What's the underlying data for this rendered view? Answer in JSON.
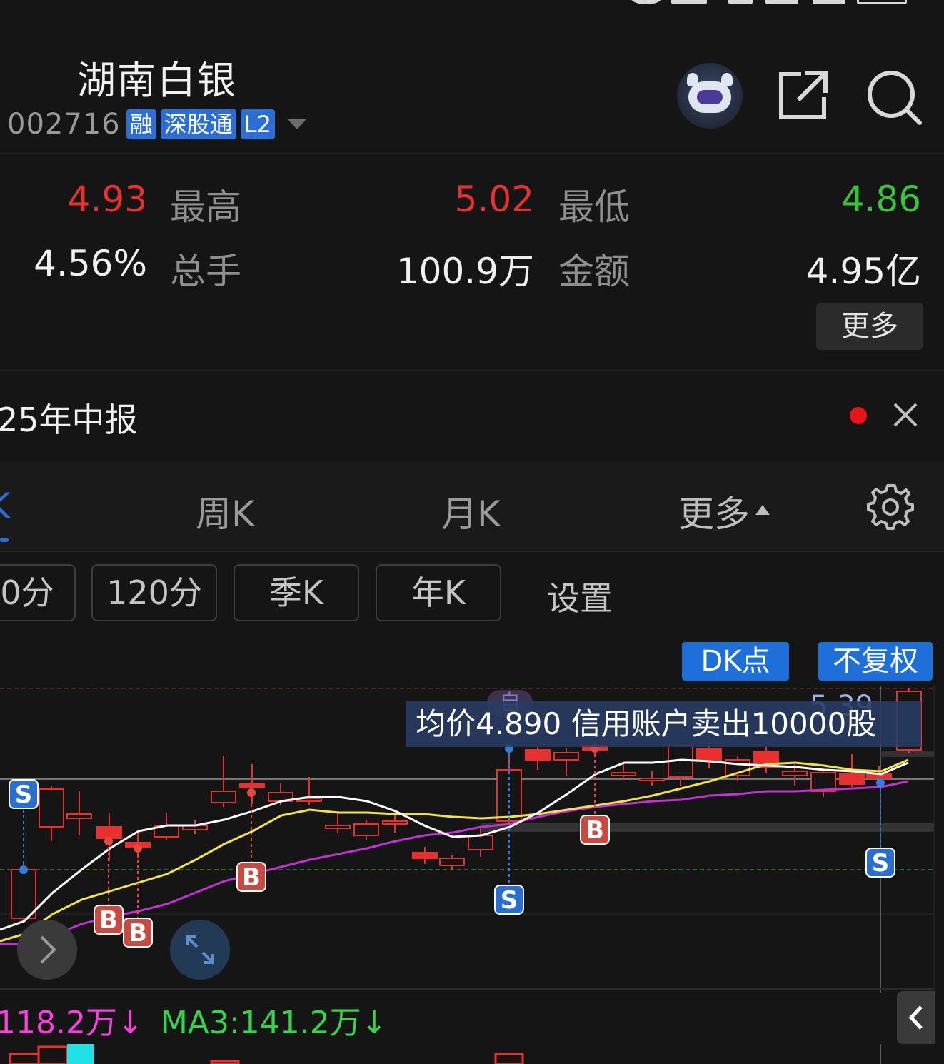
{
  "header": {
    "stock_name": "湖南白银",
    "stock_code": "002716",
    "tags": [
      "融",
      "深股通",
      "L2"
    ]
  },
  "quote": {
    "price": "4.93",
    "high_label": "最高",
    "high": "5.02",
    "low_label": "最低",
    "low": "4.86",
    "turnover_rate": "4.56%",
    "volume_label": "总手",
    "volume": "100.9万",
    "amount_label": "金额",
    "amount": "4.95亿",
    "more_label": "更多"
  },
  "notice": {
    "text": "25年中报"
  },
  "tabs": {
    "active": "K",
    "week": "周K",
    "month": "月K",
    "more": "更多"
  },
  "periods": {
    "items": [
      "0分",
      "120分",
      "季K",
      "年K"
    ],
    "settings": "设置"
  },
  "chart_controls": {
    "dk_label": "DK点",
    "adjust_label": "不复权"
  },
  "chart": {
    "tooltip": "均价4.890  信用账户卖出10000股",
    "high_price_label": "5.39",
    "self_badge": "自",
    "signal_b": "B",
    "signal_s": "S"
  },
  "volume_indicator": {
    "ma_value_1": "118.2万↓",
    "ma3_label": "MA3:141.2万↓"
  },
  "colors": {
    "up": "#e8312e",
    "down": "#35c43a",
    "accent": "#2d6ed6",
    "ma_white": "#ffffff",
    "ma_yellow": "#f2e24a",
    "ma_purple": "#c42fd6"
  },
  "chart_data": {
    "type": "candlestick",
    "signals": [
      {
        "index": 0,
        "type": "S"
      },
      {
        "index": 3,
        "type": "B"
      },
      {
        "index": 4,
        "type": "B"
      },
      {
        "index": 8,
        "type": "B"
      },
      {
        "index": 17,
        "type": "S"
      },
      {
        "index": 20,
        "type": "B"
      },
      {
        "index": 30,
        "type": "S"
      }
    ]
  }
}
